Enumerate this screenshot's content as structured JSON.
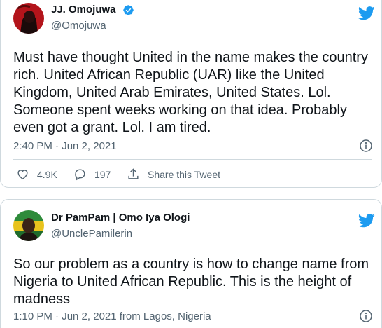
{
  "tweets": [
    {
      "author_name": "JJ. Omojuwa",
      "handle": "@Omojuwa",
      "verified": true,
      "text": "Must have thought United in the name makes the country rich. United African Republic (UAR) like the United Kingdom, United Arab Emirates, United States. Lol. Someone spent weeks working on that idea. Probably even got a grant. Lol. I am tired.",
      "timestamp": "2:40 PM · Jun 2, 2021",
      "likes": "4.9K",
      "replies": "197",
      "share_label": "Share this Tweet"
    },
    {
      "author_name": "Dr PamPam | Omo Iya Ologi",
      "handle": "@UnclePamilerin",
      "verified": false,
      "text": "So our problem as a country is how to change name from Nigeria to United African Republic. This is the height of madness",
      "timestamp": "1:10 PM · Jun 2, 2021 from Lagos, Nigeria"
    }
  ],
  "colors": {
    "twitter_blue": "#1d9bf0",
    "text_primary": "#0f1419",
    "text_secondary": "#536471",
    "border": "#cfd9de"
  },
  "icons": [
    "twitter-bird-icon",
    "verified-badge-icon",
    "info-icon",
    "heart-icon",
    "reply-icon",
    "share-icon"
  ]
}
